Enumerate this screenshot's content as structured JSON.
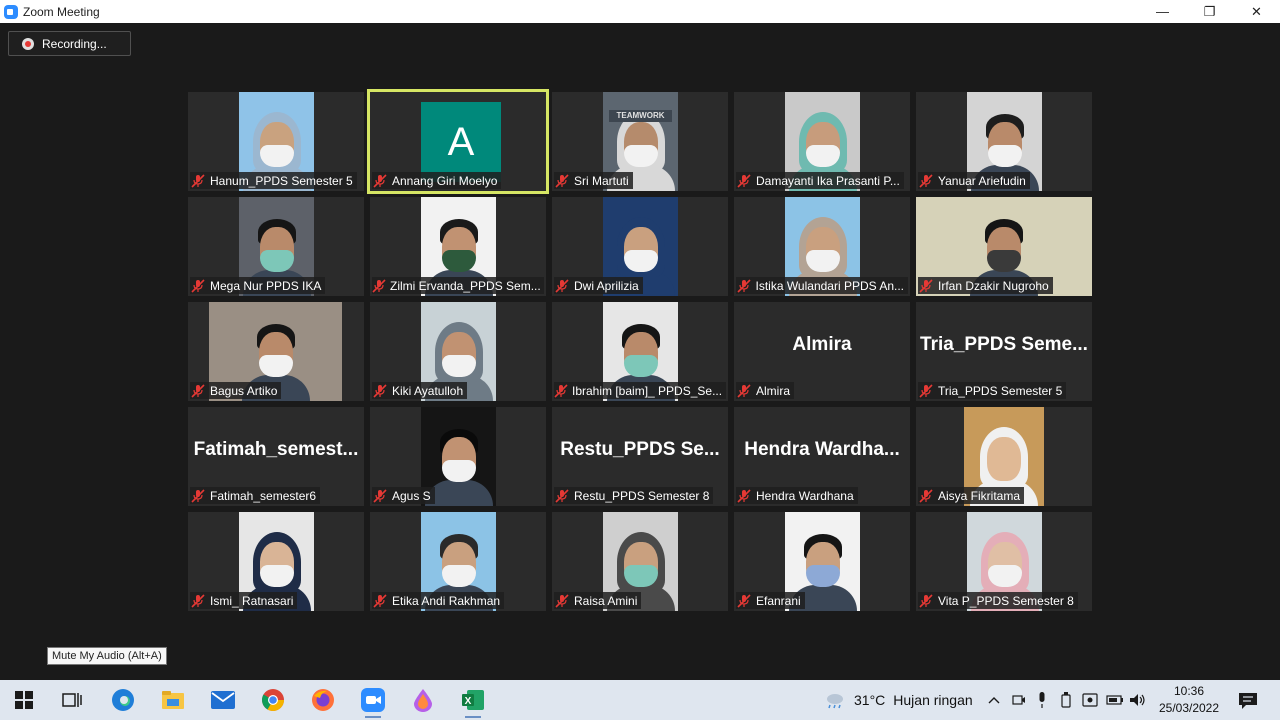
{
  "window": {
    "title": "Zoom Meeting",
    "minimize": "—",
    "restore": "❐",
    "close": "✕"
  },
  "recording": {
    "label": "Recording..."
  },
  "tooltip": "Mute My Audio (Alt+A)",
  "participants": [
    {
      "name": "Hanum_PPDS Semester 5",
      "type": "video",
      "bg": "#8fc3e8",
      "skin": "#c9a27f",
      "hijab": "#9bb7d0",
      "mask": true,
      "offset": 50
    },
    {
      "name": "Annang Giri Moelyo",
      "type": "avatar",
      "initial": "A",
      "active": true
    },
    {
      "name": "Sri Martuti",
      "type": "video",
      "bg": "#5c6670",
      "skin": "#b58b6c",
      "hijab": "#d8d8d8",
      "mask": true,
      "offset": 50,
      "poster": "TEAMWORK"
    },
    {
      "name": "Damayanti Ika Prasanti P...",
      "type": "video",
      "bg": "#c9c9c9",
      "skin": "#c79c7c",
      "hijab": "#6fbab0",
      "mask": true,
      "offset": 50
    },
    {
      "name": "Yanuar Ariefudin",
      "type": "video",
      "bg": "#d4d4d4",
      "skin": "#b98a6a",
      "hair": "#1d1d1d",
      "mask": true,
      "offset": 50
    },
    {
      "name": "Mega Nur PPDS IKA",
      "type": "video",
      "bg": "#5d6169",
      "skin": "#b98a6a",
      "hair": "#151515",
      "mask": true,
      "maskColor": "#7dc7b8",
      "offset": 50
    },
    {
      "name": "Zilmi Ervanda_PPDS Sem...",
      "type": "video",
      "bg": "#f2f2f2",
      "skin": "#c19272",
      "hair": "#1a1a1a",
      "mask": true,
      "maskColor": "#2d5a3c",
      "offset": 50
    },
    {
      "name": "Dwi Aprilizia",
      "type": "video",
      "bg": "#1f3d6e",
      "skin": "#c9a07f",
      "hijab": "#1f3d6e",
      "mask": true,
      "offset": 50
    },
    {
      "name": "Istika Wulandari PPDS An...",
      "type": "video",
      "bg": "#8cc3e6",
      "skin": "#c9a07f",
      "hijab": "#b3a394",
      "mask": true,
      "offset": 50
    },
    {
      "name": "Irfan Dzakir Nugroho",
      "type": "video",
      "bg": "#d6d2b8",
      "skin": "#b98a6a",
      "hair": "#151515",
      "mask": true,
      "maskColor": "#3a3a3a",
      "offset": 0,
      "wide": true
    },
    {
      "name": "Bagus Artiko",
      "type": "video",
      "bg": "#9a8f84",
      "skin": "#b98a6a",
      "hair": "#151515",
      "mask": true,
      "offset": 20,
      "wide": false
    },
    {
      "name": "Kiki Ayatulloh",
      "type": "video",
      "bg": "#c8d2d6",
      "skin": "#c19272",
      "hijab": "#6e7b86",
      "mask": true,
      "offset": 50
    },
    {
      "name": "Ibrahim [baim]_ PPDS_Se...",
      "type": "video",
      "bg": "#e6e6e6",
      "skin": "#b98a6a",
      "hair": "#151515",
      "mask": true,
      "maskColor": "#7dc7b8",
      "offset": 50
    },
    {
      "name": "Almira",
      "type": "name",
      "display": "Almira"
    },
    {
      "name": "Tria_PPDS Semester 5",
      "type": "name",
      "display": "Tria_PPDS  Seme..."
    },
    {
      "name": "Fatimah_semester6",
      "type": "name",
      "display": "Fatimah_semest..."
    },
    {
      "name": "Agus S",
      "type": "video",
      "bg": "#151515",
      "skin": "#c19272",
      "hair": "#0a0a0a",
      "mask": true,
      "offset": 50
    },
    {
      "name": "Restu_PPDS Semester 8",
      "type": "name",
      "display": "Restu_PPDS  Se..."
    },
    {
      "name": "Hendra Wardhana",
      "type": "name",
      "display": "Hendra  Wardha..."
    },
    {
      "name": "Aisya Fikritama",
      "type": "video",
      "bg": "#c79a5a",
      "skin": "#e0b995",
      "hijab": "#f0f0f0",
      "mask": false,
      "offset": 48,
      "small": true
    },
    {
      "name": "Ismi_ Ratnasari",
      "type": "video",
      "bg": "#e6e6e6",
      "skin": "#d9b496",
      "hijab": "#1f2c47",
      "mask": true,
      "offset": 48
    },
    {
      "name": "Etika Andi Rakhman",
      "type": "video",
      "bg": "#8cc3e6",
      "skin": "#c9a07f",
      "hair": "#2a2a2a",
      "mask": true,
      "offset": 50
    },
    {
      "name": "Raisa Amini",
      "type": "video",
      "bg": "#cfcfcf",
      "skin": "#c9a07f",
      "hijab": "#4a4a4a",
      "mask": true,
      "maskColor": "#7dc7b8",
      "offset": 50
    },
    {
      "name": "Efanrani",
      "type": "video",
      "bg": "#f2f2f2",
      "skin": "#c9a07f",
      "hair": "#151515",
      "mask": true,
      "maskColor": "#8da9d6",
      "offset": 50
    },
    {
      "name": "Vita P_PPDS Semester 8",
      "type": "video",
      "bg": "#d0d8dc",
      "skin": "#e0bfa5",
      "hijab": "#e4aeb8",
      "mask": true,
      "offset": 48
    }
  ],
  "taskbar": {
    "apps": [
      "windows-start",
      "task-view",
      "edge",
      "file-explorer",
      "mail",
      "chrome",
      "firefox",
      "zoom",
      "paint-3d",
      "excel"
    ],
    "weather": {
      "temp": "31°C",
      "condition": "Hujan ringan"
    },
    "clock": {
      "time": "10:36",
      "date": "25/03/2022"
    }
  },
  "colors": {
    "active_speaker": "#d6e664",
    "mute_red": "#e53935",
    "zoom_blue": "#2d8cff"
  }
}
